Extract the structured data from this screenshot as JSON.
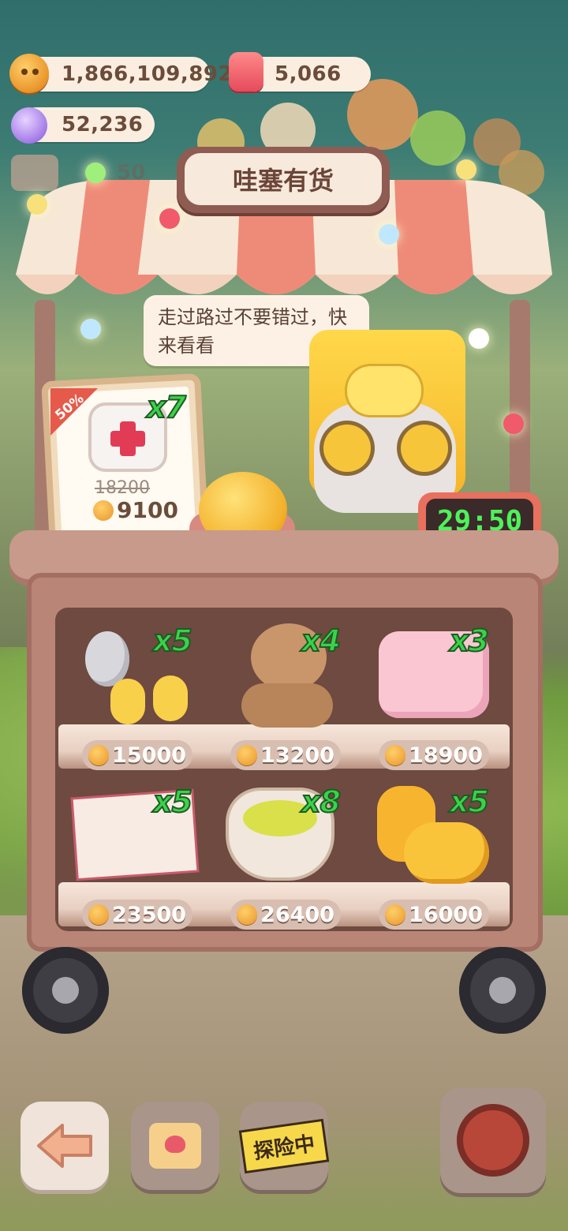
{
  "resources": {
    "coins": "1,866,109,892",
    "hearts": "5,066",
    "candy": "52,236",
    "faded_level": "50"
  },
  "stall": {
    "title": "哇塞有货",
    "speech": "走过路过不要错过，快来看看",
    "timer": "29:50"
  },
  "featured": {
    "discount": "50%",
    "quantity": "x7",
    "old_price": "18200",
    "price": "9100",
    "icon": "first-aid-kit-icon"
  },
  "shop_items": [
    {
      "name": "spoon-fork-icon",
      "quantity": "x5",
      "price": "15000"
    },
    {
      "name": "teddy-bear-icon",
      "quantity": "x4",
      "price": "13200"
    },
    {
      "name": "pillow-icon",
      "quantity": "x3",
      "price": "18900"
    },
    {
      "name": "magazine-icon",
      "quantity": "x5",
      "price": "23500"
    },
    {
      "name": "tea-cup-icon",
      "quantity": "x8",
      "price": "26400"
    },
    {
      "name": "slippers-icon",
      "quantity": "x5",
      "price": "16000"
    }
  ],
  "bottom_bar": {
    "adventure_label": "探险中"
  },
  "colors": {
    "price_text": "#ffffff",
    "quantity_green": "#3bd24a",
    "timer_digits": "#4ef25a"
  }
}
